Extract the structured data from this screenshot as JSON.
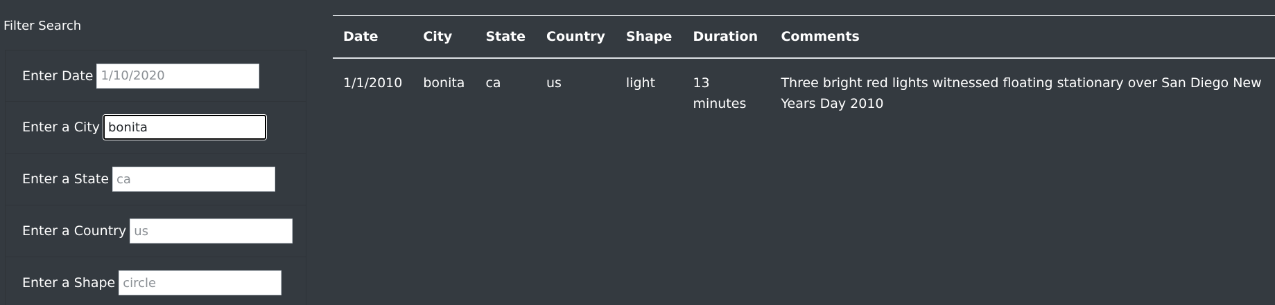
{
  "filter": {
    "title": "Filter Search",
    "fields": [
      {
        "label": "Enter Date",
        "placeholder": "1/10/2020",
        "value": ""
      },
      {
        "label": "Enter a City",
        "placeholder": "",
        "value": "bonita"
      },
      {
        "label": "Enter a State",
        "placeholder": "ca",
        "value": ""
      },
      {
        "label": "Enter a Country",
        "placeholder": "us",
        "value": ""
      },
      {
        "label": "Enter a Shape",
        "placeholder": "circle",
        "value": ""
      }
    ]
  },
  "table": {
    "headers": [
      "Date",
      "City",
      "State",
      "Country",
      "Shape",
      "Duration",
      "Comments"
    ],
    "rows": [
      {
        "date": "1/1/2010",
        "city": "bonita",
        "state": "ca",
        "country": "us",
        "shape": "light",
        "duration": "13 minutes",
        "comments": "Three bright red lights witnessed floating stationary over San Diego New Years Day 2010"
      }
    ]
  }
}
